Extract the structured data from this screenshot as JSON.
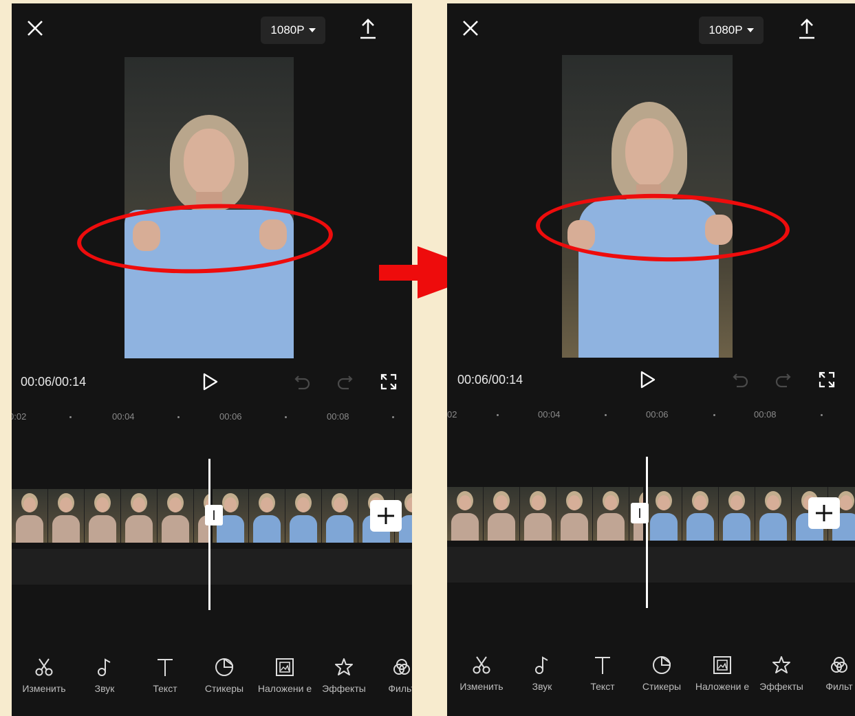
{
  "resolution_label": "1080P",
  "time_display": "00:06/00:14",
  "ruler_ticks_left": [
    "0:02",
    "00:04",
    "00:06",
    "00:08"
  ],
  "ruler_ticks_right": [
    "02",
    "00:04",
    "00:06",
    "00:08"
  ],
  "toolbar_items": [
    {
      "label": "Изменить",
      "icon": "scissors-icon"
    },
    {
      "label": "Звук",
      "icon": "music-note-icon"
    },
    {
      "label": "Текст",
      "icon": "text-icon"
    },
    {
      "label": "Стикеры",
      "icon": "sticker-icon"
    },
    {
      "label": "Наложени е",
      "icon": "overlay-icon"
    },
    {
      "label": "Эффекты",
      "icon": "effects-star-icon"
    },
    {
      "label": "Фильт",
      "icon": "filter-icon"
    }
  ],
  "colors": {
    "background": "#f7ebce",
    "app_bg": "#141414",
    "highlight": "#ee0c0c",
    "sweater": "#8fb3e0"
  }
}
